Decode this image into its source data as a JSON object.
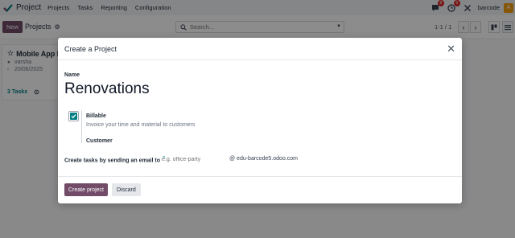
{
  "navbar": {
    "app_name": "Project",
    "menu": [
      "Projects",
      "Tasks",
      "Reporting",
      "Configuration"
    ],
    "chat_count": "8",
    "activity_count": "5",
    "company": "barcode",
    "avatar_letter": "A",
    "icons": [
      "project-check-icon",
      "chat-icon",
      "clock-icon",
      "tools-icon"
    ]
  },
  "control_panel": {
    "new_label": "New",
    "breadcrumb": "Projects",
    "search_placeholder": "Search...",
    "pager": "1-1 / 1"
  },
  "background_card": {
    "title": "Mobile App I",
    "user": "varsha",
    "date": "20/06/2025",
    "tasks": "3 Tasks"
  },
  "modal": {
    "title": "Create a Project",
    "name_label": "Name",
    "name_value": "Renovations",
    "billable_label": "Billable",
    "billable_checked": true,
    "billable_help": "Invoice your time and material to customers",
    "customer_label": "Customer",
    "alias_label": "Create tasks by sending an email to",
    "alias_help_marker": "?",
    "alias_placeholder": "e.g. office-party",
    "alias_domain": "@ edu-barcode5.odoo.com",
    "create_button": "Create project",
    "discard_button": "Discard"
  },
  "colors": {
    "brand": "#714b67",
    "accent": "#017e84",
    "badge": "#dc2626"
  }
}
